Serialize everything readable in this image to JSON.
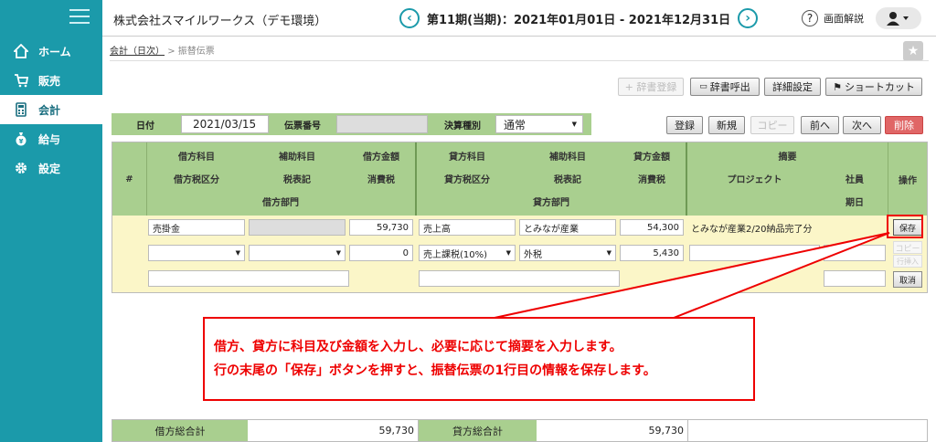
{
  "sidebar": {
    "items": [
      {
        "label": "ホーム",
        "icon": "home-icon"
      },
      {
        "label": "販売",
        "icon": "cart-icon"
      },
      {
        "label": "会計",
        "icon": "calculator-icon"
      },
      {
        "label": "給与",
        "icon": "money-bag-icon"
      },
      {
        "label": "設定",
        "icon": "gear-icon"
      }
    ],
    "active_index": 2
  },
  "header": {
    "company": "株式会社スマイルワークス（デモ環境）",
    "period": "第11期(当期)：2021年01月01日 - 2021年12月31日",
    "help_label": "画面解説"
  },
  "breadcrumb": {
    "parent": "会計（日次）",
    "separator": ">",
    "current": "振替伝票"
  },
  "toolbar": {
    "register_dict": "+ 辞書登録",
    "load_dict": "辞書呼出",
    "detail_settings": "詳細設定",
    "shortcut": "ショートカット"
  },
  "form": {
    "date_label": "日付",
    "date_value": "2021/03/15",
    "voucher_no_label": "伝票番号",
    "voucher_no_value": "",
    "settlement_label": "決算種別",
    "settlement_value": "通常"
  },
  "actions": {
    "register": "登録",
    "new": "新規",
    "copy": "コピー",
    "prev": "前へ",
    "next": "次へ",
    "delete": "削除"
  },
  "grid_header": {
    "hash": "#",
    "debit_account": "借方科目",
    "debit_sub": "補助科目",
    "debit_amount": "借方金額",
    "debit_tax_cat": "借方税区分",
    "debit_tax_note": "税表記",
    "debit_tax": "消費税",
    "debit_dept": "借方部門",
    "credit_account": "貸方科目",
    "credit_sub": "補助科目",
    "credit_amount": "貸方金額",
    "credit_tax_cat": "貸方税区分",
    "credit_tax_note": "税表記",
    "credit_tax": "消費税",
    "credit_dept": "貸方部門",
    "memo": "摘要",
    "project": "プロジェクト",
    "employee": "社員",
    "due_date": "期日",
    "operation": "操作"
  },
  "row": {
    "debit_account": "売掛金",
    "debit_amount": "59,730",
    "debit_tax": "0",
    "credit_account": "売上高",
    "credit_sub": "とみなが産業",
    "credit_amount": "54,300",
    "credit_tax_cat": "売上課税(10%)",
    "credit_tax_note": "外税",
    "credit_tax": "5,430",
    "memo": "とみなが産業2/20納品完了分",
    "save": "保存",
    "copy": "コピー",
    "insert": "行挿入",
    "cancel": "取消"
  },
  "callout": {
    "line1": "借方、貸方に科目及び金額を入力し、必要に応じて摘要を入力します。",
    "line2": "行の末尾の「保存」ボタンを押すと、振替伝票の1行目の情報を保存します。"
  },
  "totals": {
    "debit_label": "借方総合計",
    "debit_value": "59,730",
    "credit_label": "貸方総合計",
    "credit_value": "59,730"
  },
  "colors": {
    "sidebar": "#1b9aaa",
    "grid_header": "#a9cf8f",
    "grid_body": "#fbf6c8",
    "annotation": "#e00000",
    "delete_button": "#e06666"
  }
}
